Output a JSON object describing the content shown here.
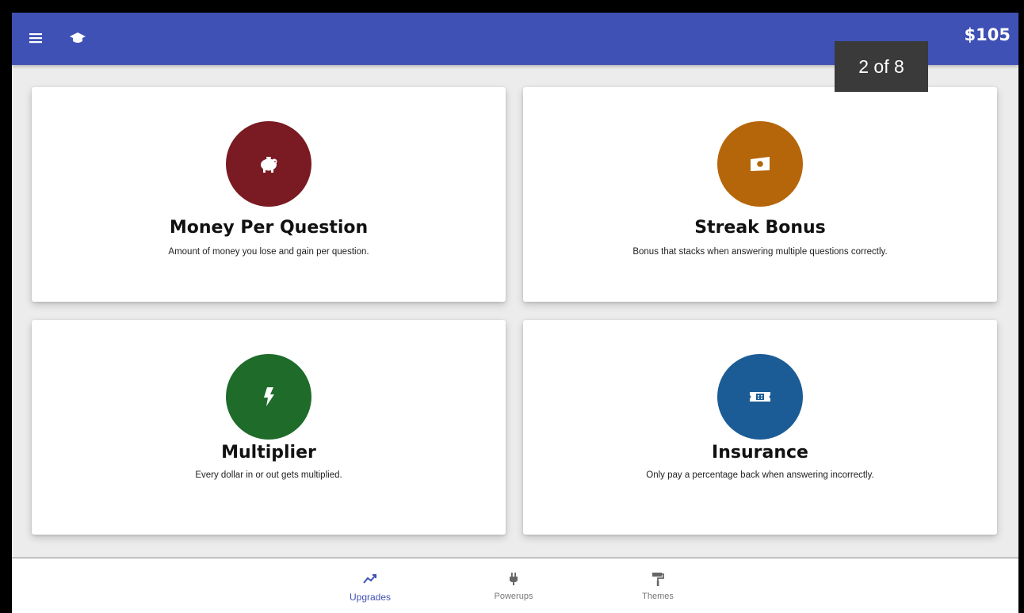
{
  "app": {
    "balance": "$105"
  },
  "overlay": {
    "page_indicator": "2 of 8"
  },
  "cards": [
    {
      "title": "Money Per Question",
      "description": "Amount of money you lose and gain per question.",
      "icon": "piggy-bank-icon",
      "color": "#7a1a22"
    },
    {
      "title": "Streak Bonus",
      "description": "Bonus that stacks when answering multiple questions correctly.",
      "icon": "cash-icon",
      "color": "#b5660a"
    },
    {
      "title": "Multiplier",
      "description": "Every dollar in or out gets multiplied.",
      "icon": "lightning-icon",
      "color": "#1e6b2a"
    },
    {
      "title": "Insurance",
      "description": "Only pay a percentage back when answering incorrectly.",
      "icon": "ticket-icon",
      "color": "#1b5c96"
    }
  ],
  "bottom_nav": {
    "items": [
      {
        "label": "Upgrades",
        "icon": "trending-up-icon",
        "active": true
      },
      {
        "label": "Powerups",
        "icon": "plug-icon",
        "active": false
      },
      {
        "label": "Themes",
        "icon": "paint-roller-icon",
        "active": false
      }
    ]
  },
  "colors": {
    "appbar": "#3f51b5",
    "accent": "#3f51b5",
    "background": "#ececec"
  }
}
